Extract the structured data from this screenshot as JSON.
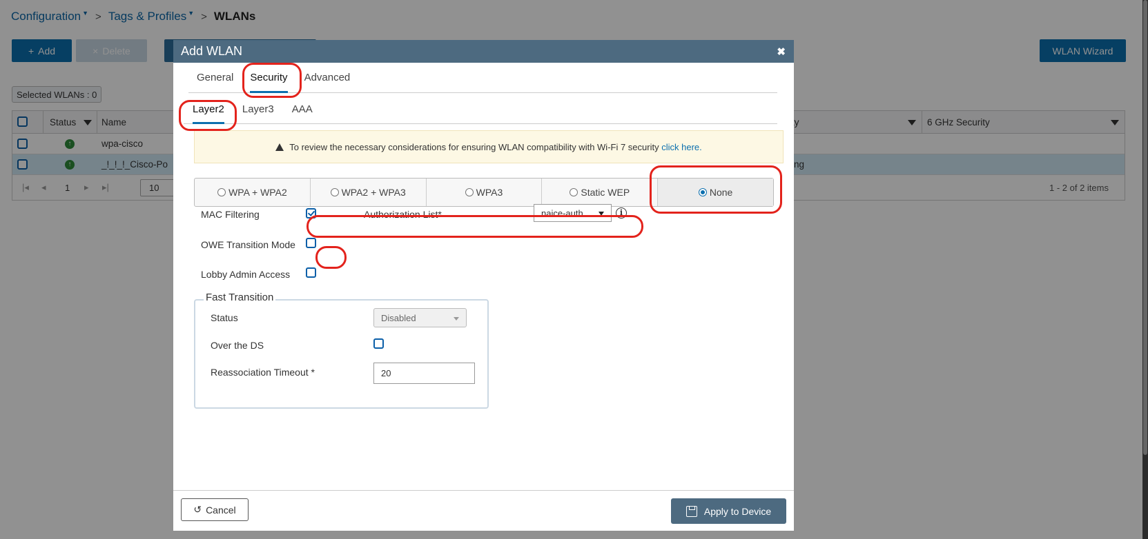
{
  "breadcrumb": {
    "items": [
      "Configuration",
      "Tags & Profiles",
      "WLANs"
    ]
  },
  "toolbar": {
    "add_label": "Add",
    "delete_label": "Delete",
    "wizard_label": "WLAN Wizard"
  },
  "grid": {
    "selected_label": "Selected WLANs : 0",
    "columns": [
      "Status",
      "Name",
      "ty",
      "6 GHz Security"
    ],
    "rows": [
      {
        "name": "wpa-cisco",
        "security": "]"
      },
      {
        "name": "_!_!_!_Cisco-Po",
        "security": "ing"
      }
    ],
    "page": "1",
    "page_size": "10",
    "summary": "1 - 2 of 2 items"
  },
  "modal": {
    "title": "Add WLAN",
    "tabs": [
      "General",
      "Security",
      "Advanced"
    ],
    "subtabs": [
      "Layer2",
      "Layer3",
      "AAA"
    ],
    "notice": {
      "text": "To review the necessary considerations for ensuring WLAN compatibility with Wi-Fi 7 security",
      "link": "click here."
    },
    "security_options": [
      "WPA + WPA2",
      "WPA2 + WPA3",
      "WPA3",
      "Static WEP",
      "None"
    ],
    "selected_option": "None",
    "mac_filtering_label": "MAC Filtering",
    "authorization_list_label": "Authorization List*",
    "authorization_list_value": "naice-auth...",
    "owe_label": "OWE Transition Mode",
    "lobby_label": "Lobby Admin Access",
    "fast_transition": {
      "legend": "Fast Transition",
      "status_label": "Status",
      "status_value": "Disabled",
      "over_ds_label": "Over the DS",
      "reassoc_label": "Reassociation Timeout *",
      "reassoc_value": "20"
    },
    "cancel_label": "Cancel",
    "apply_label": "Apply to Device"
  },
  "colors": {
    "primary": "#0c6fae",
    "modal_header": "#4d6a80",
    "highlight": "#e3231c",
    "notice_bg": "#fdf8e4"
  }
}
